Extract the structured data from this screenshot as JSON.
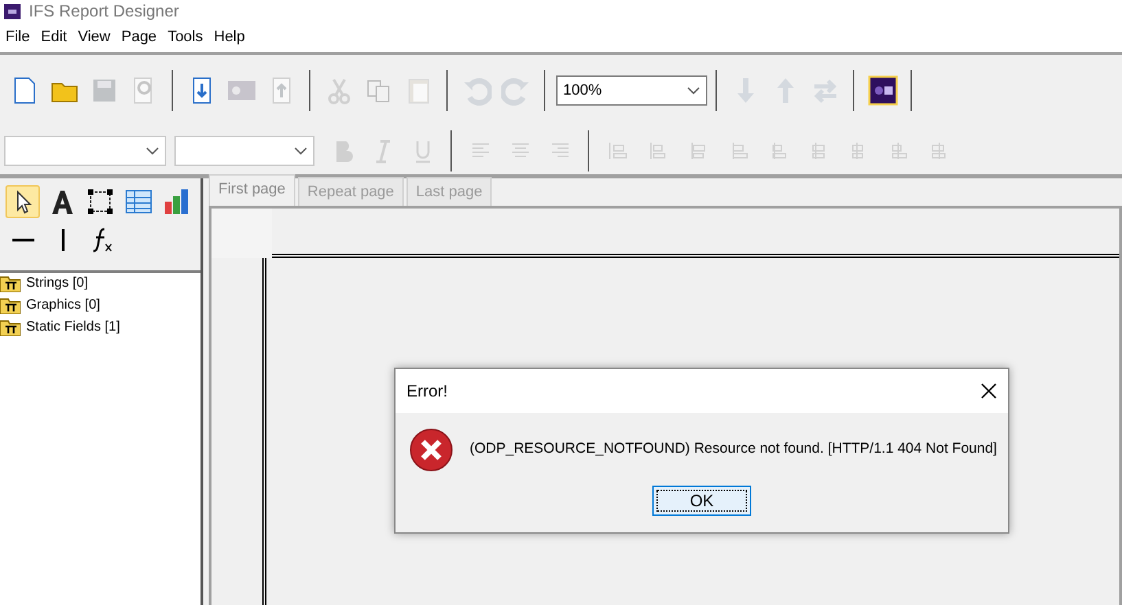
{
  "window": {
    "title": "IFS Report Designer"
  },
  "menu": [
    "File",
    "Edit",
    "View",
    "Page",
    "Tools",
    "Help"
  ],
  "toolbar": [
    {
      "kind": "new",
      "disabled": false
    },
    {
      "kind": "open",
      "disabled": false
    },
    {
      "kind": "save",
      "disabled": true
    },
    {
      "kind": "preview",
      "disabled": true
    },
    {
      "kind": "sep"
    },
    {
      "kind": "import",
      "disabled": false
    },
    {
      "kind": "ifsdb",
      "disabled": true
    },
    {
      "kind": "export",
      "disabled": true
    },
    {
      "kind": "sep"
    },
    {
      "kind": "cut",
      "disabled": true
    },
    {
      "kind": "copy",
      "disabled": true
    },
    {
      "kind": "paste",
      "disabled": true
    },
    {
      "kind": "sep"
    },
    {
      "kind": "undo",
      "disabled": true
    },
    {
      "kind": "redo",
      "disabled": true
    },
    {
      "kind": "sep"
    },
    {
      "kind": "zoom",
      "value": "100%"
    },
    {
      "kind": "sep"
    },
    {
      "kind": "down",
      "disabled": true
    },
    {
      "kind": "up",
      "disabled": true
    },
    {
      "kind": "swap",
      "disabled": true
    },
    {
      "kind": "sep"
    },
    {
      "kind": "ifs",
      "disabled": false
    },
    {
      "kind": "sep"
    }
  ],
  "format_toolbar": [
    {
      "kind": "font"
    },
    {
      "kind": "size"
    },
    {
      "kind": "bold",
      "disabled": true
    },
    {
      "kind": "italic",
      "disabled": true
    },
    {
      "kind": "underline",
      "disabled": true
    },
    {
      "kind": "sep"
    },
    {
      "kind": "left",
      "disabled": true
    },
    {
      "kind": "center",
      "disabled": true
    },
    {
      "kind": "right",
      "disabled": true
    },
    {
      "kind": "sep"
    },
    {
      "kind": "al1",
      "disabled": true
    },
    {
      "kind": "al2",
      "disabled": true
    },
    {
      "kind": "al3",
      "disabled": true
    },
    {
      "kind": "al4",
      "disabled": true
    },
    {
      "kind": "al5",
      "disabled": true
    },
    {
      "kind": "al6",
      "disabled": true
    },
    {
      "kind": "al7",
      "disabled": true
    },
    {
      "kind": "al8",
      "disabled": true
    },
    {
      "kind": "al9",
      "disabled": true
    }
  ],
  "palette": [
    [
      {
        "kind": "pointer",
        "selected": true
      },
      {
        "kind": "text",
        "selected": false
      },
      {
        "kind": "frame",
        "selected": false
      },
      {
        "kind": "table",
        "selected": false
      },
      {
        "kind": "chart",
        "selected": false
      }
    ],
    [
      {
        "kind": "hline",
        "selected": false
      },
      {
        "kind": "vline",
        "selected": false
      },
      {
        "kind": "function",
        "selected": false
      }
    ]
  ],
  "tree": [
    {
      "label": "Strings [0]"
    },
    {
      "label": "Graphics [0]"
    },
    {
      "label": "Static Fields [1]"
    }
  ],
  "tabs": [
    {
      "label": "First page",
      "selected": true
    },
    {
      "label": "Repeat page",
      "selected": false
    },
    {
      "label": "Last page",
      "selected": false
    }
  ],
  "dialog": {
    "title": "Error!",
    "message": "(ODP_RESOURCE_NOTFOUND) Resource not found. [HTTP/1.1 404 Not Found]",
    "button": "OK"
  }
}
